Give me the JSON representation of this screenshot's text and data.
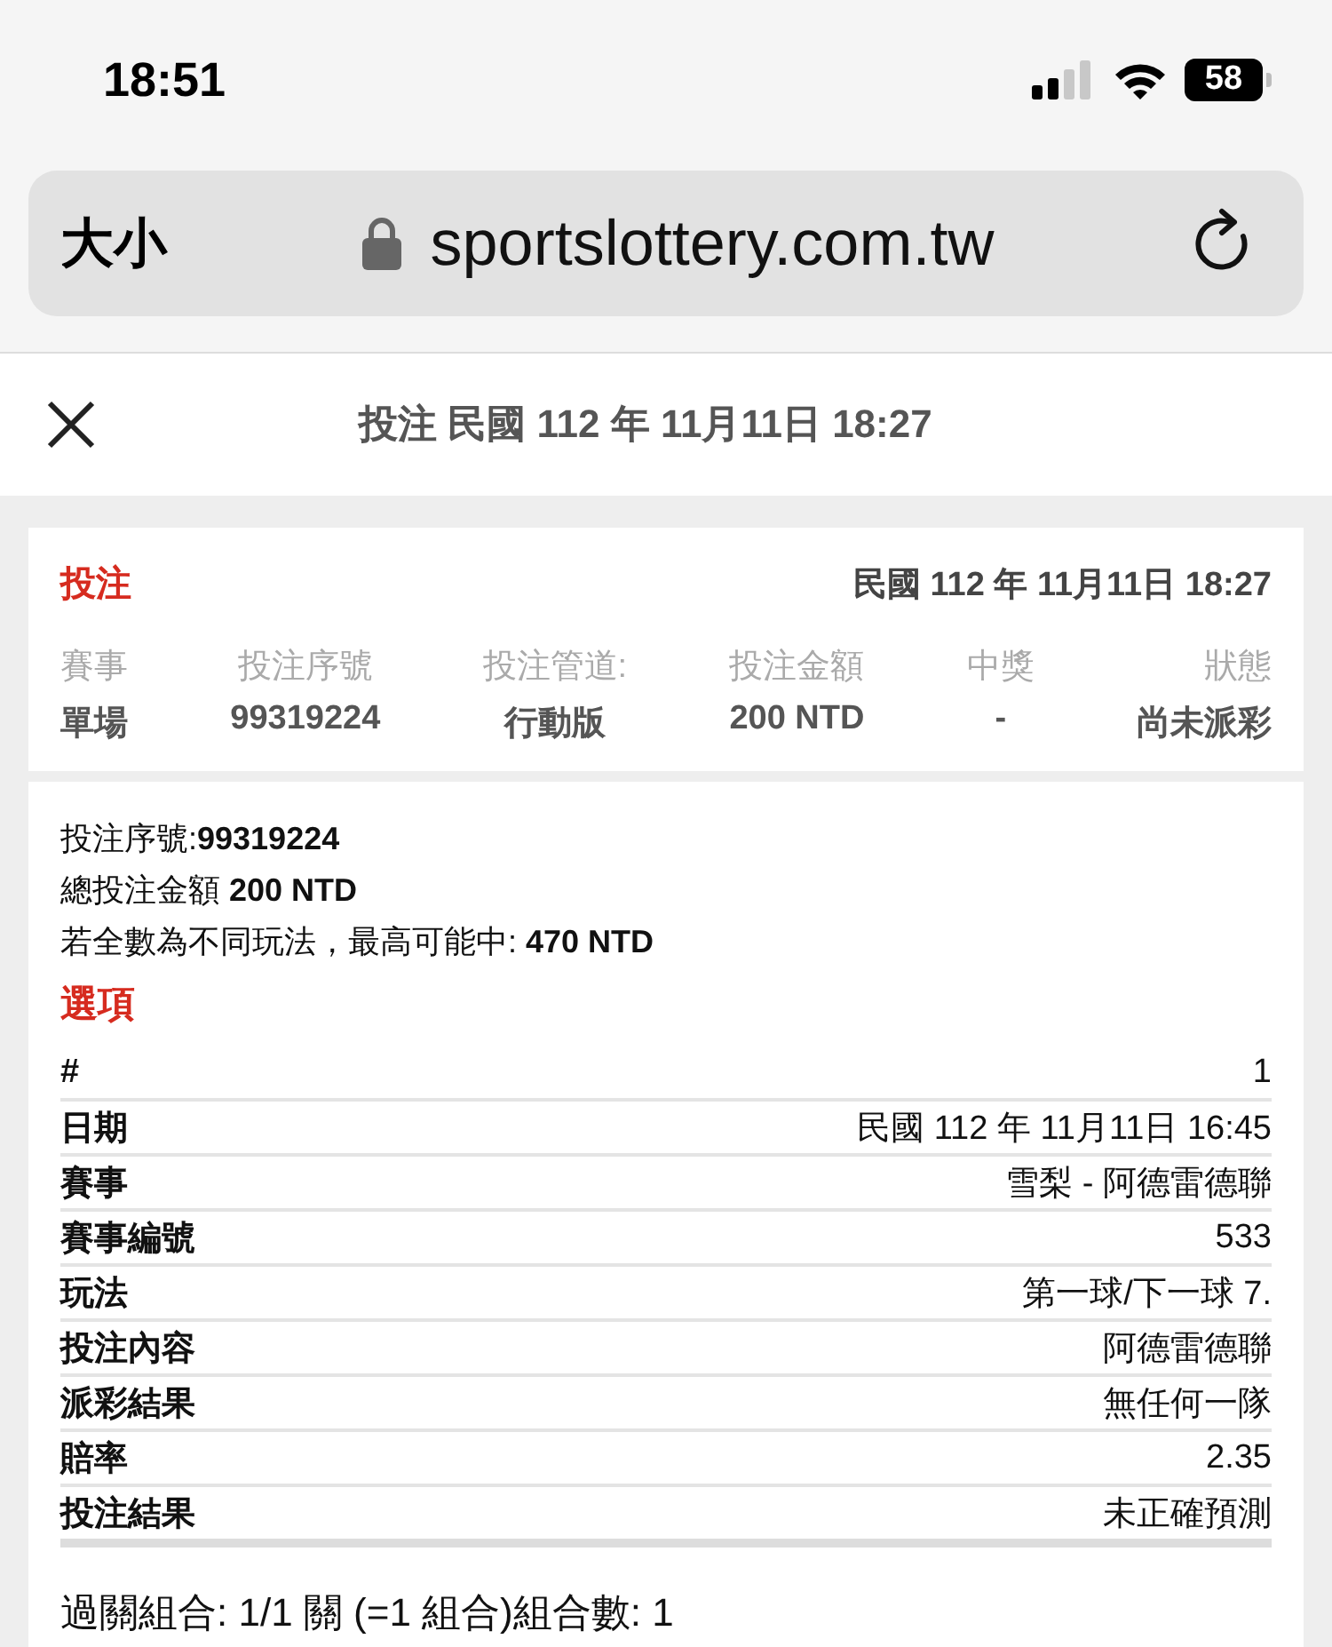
{
  "status_bar": {
    "time": "18:51",
    "battery": "58"
  },
  "address_bar": {
    "text_size_button": "大小",
    "url": "sportslottery.com.tw"
  },
  "header": {
    "title": "投注 民國 112 年 11月11日 18:27"
  },
  "bet_card": {
    "label": "投注",
    "datetime": "民國 112 年 11月11日 18:27",
    "columns": [
      {
        "heading": "賽事",
        "value": "單場"
      },
      {
        "heading": "投注序號",
        "value": "99319224"
      },
      {
        "heading": "投注管道:",
        "value": "行動版"
      },
      {
        "heading": "投注金額",
        "value": "200 NTD"
      },
      {
        "heading": "中獎",
        "value": "-"
      },
      {
        "heading": "狀態",
        "value": "尚未派彩"
      }
    ]
  },
  "details": {
    "summary": [
      "投注序號:**99319224**",
      "總投注金額 **200 NTD**",
      "若全數為不同玩法，最高可能中: **470 NTD**"
    ],
    "options_title": "選項",
    "rows": [
      {
        "label": "#",
        "value": "1"
      },
      {
        "label": "日期",
        "value": "民國 112 年 11月11日 16:45"
      },
      {
        "label": "賽事",
        "value": "雪梨 - 阿德雷德聯"
      },
      {
        "label": "賽事編號",
        "value": "533"
      },
      {
        "label": "玩法",
        "value": "第一球/下一球 7."
      },
      {
        "label": "投注內容",
        "value": "阿德雷德聯"
      },
      {
        "label": "派彩結果",
        "value": "無任何一隊"
      },
      {
        "label": "賠率",
        "value": "2.35"
      },
      {
        "label": "投注結果",
        "value": "未正確預測"
      }
    ],
    "combination": "過關組合: 1/1 關 (=1 組合)組合數: 1"
  }
}
